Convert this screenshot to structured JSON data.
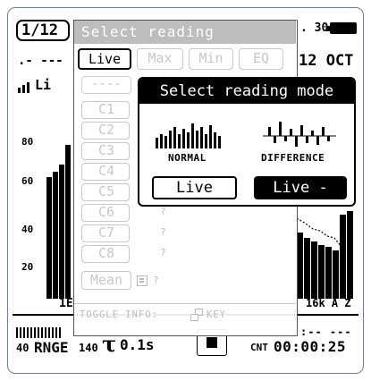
{
  "status": {
    "page_indicator": "1/12",
    "clock_fragment": ". 30",
    "date_fragment": "12 OCT",
    "left_dashes": ".- ---",
    "channel_fragment": "Li"
  },
  "graph": {
    "y_ticks": [
      "80",
      "60",
      "40",
      "20"
    ],
    "x_left": "1E",
    "x_right": "16k A Z"
  },
  "footer": {
    "range_min": "40",
    "range_label": "RNGE",
    "range_max": "140",
    "tau_symbol": "τ",
    "tau_value": "0.1s",
    "stop_icon": "stop-square-icon",
    "time_dashes": ":-- ---",
    "count_label": "CNT",
    "count_time": "00:00:25"
  },
  "reading_panel": {
    "title": "Select reading",
    "tabs": [
      "Live",
      "Max",
      "Min",
      "EQ"
    ],
    "active_tab": "Live",
    "blank_field": "----",
    "channels": [
      {
        "label": "C1",
        "value": ""
      },
      {
        "label": "C2",
        "value": ""
      },
      {
        "label": "C3",
        "value": ""
      },
      {
        "label": "C4",
        "value": ""
      },
      {
        "label": "C5",
        "value": ""
      },
      {
        "label": "C6",
        "value": "?"
      },
      {
        "label": "C7",
        "value": "?"
      },
      {
        "label": "C8",
        "value": "?"
      }
    ],
    "mean_label": "Mean",
    "mean_value": "?",
    "toggle_info": "TOGGLE INFO:",
    "toggle_key": "KEY"
  },
  "mode_popup": {
    "title": "Select reading mode",
    "normal_label": "NORMAL",
    "difference_label": "DIFFERENCE",
    "live_button": "Live",
    "live_diff_button": "Live - ..."
  },
  "colors": {
    "frame_border": "#6c7f95",
    "panel_title_bg": "#bdbdbd",
    "disabled_text": "#c8c8c8"
  }
}
